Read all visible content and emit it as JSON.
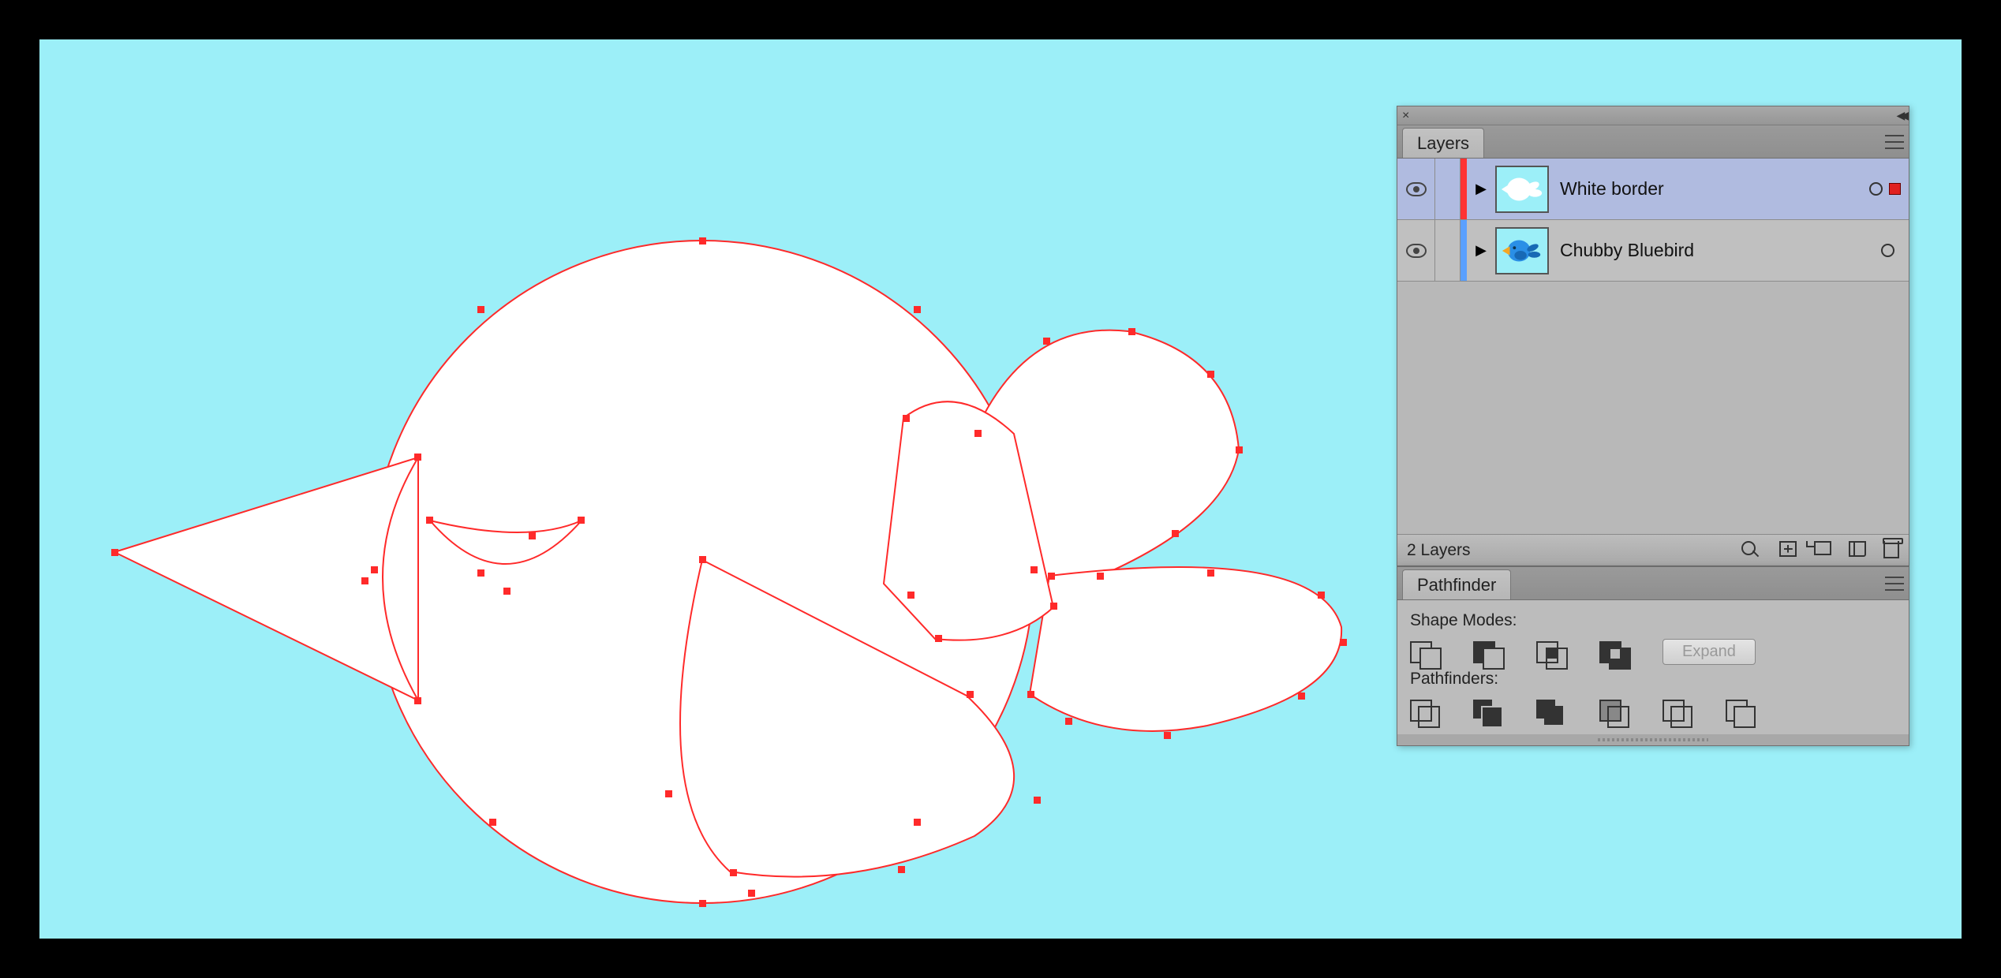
{
  "canvas": {
    "bg": "#9ceff8",
    "artwork": "bird-white-outlined-selected"
  },
  "layers_panel": {
    "tab_label": "Layers",
    "footer_count": "2 Layers",
    "layers": [
      {
        "name": "White border",
        "selected": true,
        "visible": true,
        "color": "#ff3333",
        "has_selection_indicator": true,
        "thumb": "white-bird"
      },
      {
        "name": "Chubby Bluebird",
        "selected": false,
        "visible": true,
        "color": "#5aa0ff",
        "has_selection_indicator": false,
        "thumb": "blue-bird"
      }
    ]
  },
  "pathfinder_panel": {
    "tab_label": "Pathfinder",
    "section1": "Shape Modes:",
    "section2": "Pathfinders:",
    "expand_label": "Expand",
    "expand_enabled": false,
    "shape_modes": [
      "unite",
      "minus-front",
      "intersect",
      "exclude"
    ],
    "pathfinders": [
      "divide",
      "trim",
      "merge",
      "crop",
      "outline",
      "minus-back"
    ]
  }
}
